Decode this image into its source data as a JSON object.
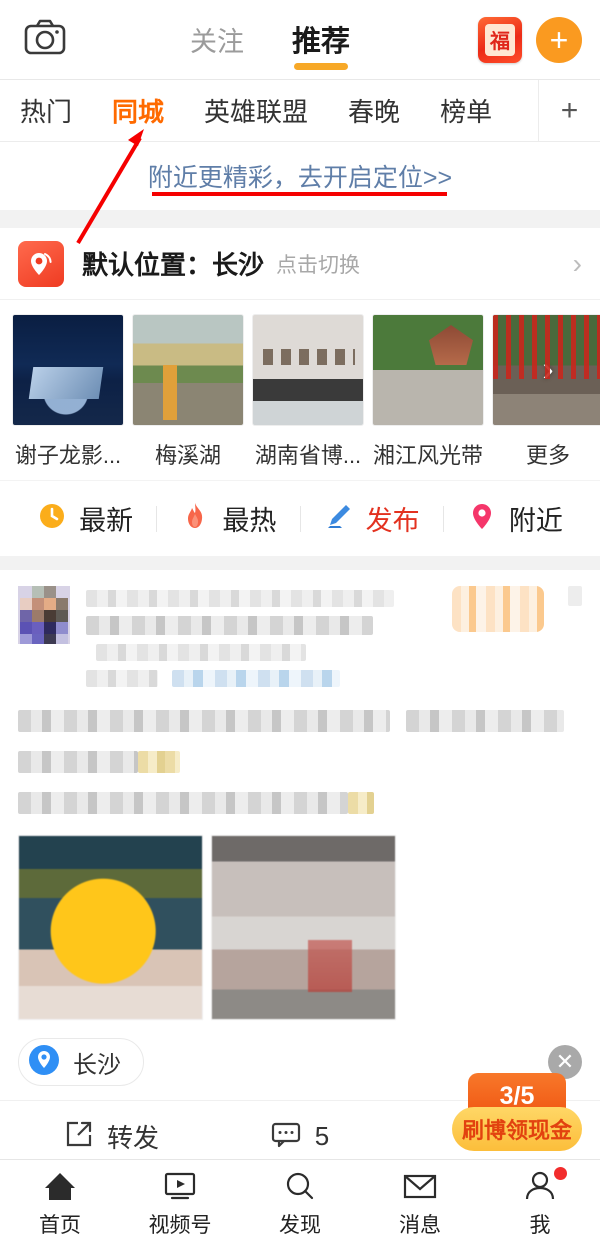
{
  "topbar": {
    "camera_icon": "camera-icon",
    "tabs": [
      {
        "label": "关注",
        "active": false
      },
      {
        "label": "推荐",
        "active": true
      }
    ],
    "fu_card_label": "福",
    "plus_label": "+"
  },
  "subtabs": {
    "items": [
      {
        "label": "热门",
        "active": false
      },
      {
        "label": "同城",
        "active": true
      },
      {
        "label": "英雄联盟",
        "active": false
      },
      {
        "label": "春晚",
        "active": false
      },
      {
        "label": "榜单",
        "active": false
      }
    ],
    "add_label": "+"
  },
  "locate_prompt": {
    "link_text": "附近更精彩，去开启定位>>"
  },
  "location_row": {
    "title": "默认位置：长沙",
    "hint": "点击切换",
    "chevron": "›"
  },
  "places": [
    {
      "label": "谢子龙影...",
      "thumb": "place-photo-1"
    },
    {
      "label": "梅溪湖",
      "thumb": "place-photo-2"
    },
    {
      "label": "湖南省博...",
      "thumb": "place-photo-3"
    },
    {
      "label": "湘江风光带",
      "thumb": "place-photo-4"
    },
    {
      "label": "更多",
      "thumb": "place-photo-5",
      "overlay": "›"
    }
  ],
  "actions": [
    {
      "label": "最新",
      "icon": "clock-icon",
      "color": "#222222"
    },
    {
      "label": "最热",
      "icon": "flame-icon",
      "color": "#222222"
    },
    {
      "label": "发布",
      "icon": "pencil-icon",
      "color": "#e3311f"
    },
    {
      "label": "附近",
      "icon": "pin-icon",
      "color": "#222222"
    }
  ],
  "post": {
    "avatar": "user-avatar-blurred",
    "geo_chip_label": "长沙",
    "close_label": "✕",
    "actions": [
      {
        "label": "转发",
        "icon": "share-icon"
      },
      {
        "label": "5",
        "icon": "comment-icon"
      }
    ]
  },
  "cash_badge": {
    "count": "3/5",
    "label": "刷博领现金"
  },
  "bottomnav": [
    {
      "label": "首页",
      "icon": "home-icon",
      "active": true,
      "badge": false
    },
    {
      "label": "视频号",
      "icon": "video-icon",
      "active": false,
      "badge": false
    },
    {
      "label": "发现",
      "icon": "search-icon",
      "active": false,
      "badge": false
    },
    {
      "label": "消息",
      "icon": "mail-icon",
      "active": false,
      "badge": false
    },
    {
      "label": "我",
      "icon": "person-icon",
      "active": false,
      "badge": true
    }
  ],
  "colors": {
    "accent_orange": "#ff6a00",
    "tab_underline": "#f7a827",
    "link_blue": "#5f7ea8",
    "annotation_red": "#f50000",
    "publish_red": "#e3311f",
    "badge_red": "#f22c2c"
  }
}
